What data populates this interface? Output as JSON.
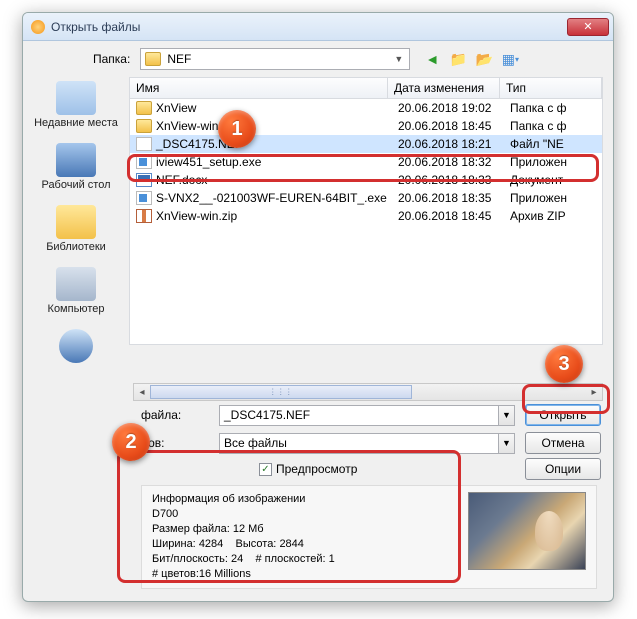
{
  "window": {
    "title": "Открыть файлы"
  },
  "toolbar": {
    "folder_label": "Папка:",
    "folder_value": "NEF"
  },
  "columns": {
    "name": "Имя",
    "date": "Дата изменения",
    "type": "Тип"
  },
  "places": [
    {
      "label": "Недавние места"
    },
    {
      "label": "Рабочий стол"
    },
    {
      "label": "Библиотеки"
    },
    {
      "label": "Компьютер"
    }
  ],
  "files": [
    {
      "name": "XnView",
      "date": "20.06.2018 19:02",
      "type": "Папка с ф",
      "icon": "folder",
      "sel": false
    },
    {
      "name": "XnView-win",
      "date": "20.06.2018 18:45",
      "type": "Папка с ф",
      "icon": "folder",
      "sel": false
    },
    {
      "name": "_DSC4175.NEF",
      "date": "20.06.2018 18:21",
      "type": "Файл \"NE",
      "icon": "file",
      "sel": true
    },
    {
      "name": "iview451_setup.exe",
      "date": "20.06.2018 18:32",
      "type": "Приложен",
      "icon": "exe",
      "sel": false
    },
    {
      "name": "NEF.docx",
      "date": "20.06.2018 18:33",
      "type": "Документ",
      "icon": "doc",
      "sel": false
    },
    {
      "name": "S-VNX2__-021003WF-EUREN-64BIT_.exe",
      "date": "20.06.2018 18:35",
      "type": "Приложен",
      "icon": "exe",
      "sel": false
    },
    {
      "name": "XnView-win.zip",
      "date": "20.06.2018 18:45",
      "type": "Архив ZIP",
      "icon": "zip",
      "sel": false
    }
  ],
  "form": {
    "filename_label": "файла:",
    "filename_value": "_DSC4175.NEF",
    "filter_label": "лов:",
    "filter_value": "Все файлы",
    "preview_label": "Предпросмотр",
    "open": "Открыть",
    "cancel": "Отмена",
    "options": "Опции"
  },
  "info": {
    "heading": "Информация об изображении",
    "model": "D700",
    "size_label": "Размер файла:",
    "size_value": "12 Мб",
    "width_label": "Ширина:",
    "width_value": "4284",
    "height_label": "Высота:",
    "height_value": "2844",
    "bits_label": "Бит/плоскость:",
    "bits_value": "24",
    "planes_label": "# плоскостей:",
    "planes_value": "1",
    "colors_label": "# цветов:",
    "colors_value": "16 Millions"
  },
  "badges": {
    "b1": "1",
    "b2": "2",
    "b3": "3"
  }
}
